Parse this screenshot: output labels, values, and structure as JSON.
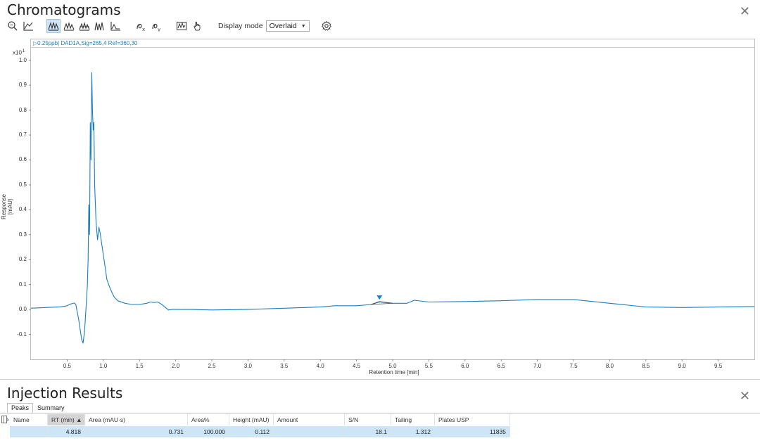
{
  "chromatograms": {
    "title": "Chromatograms",
    "display_mode_label": "Display mode",
    "display_mode_value": "Overlaid",
    "toolbar_icons": [
      "zoom-icon",
      "baseline-icon",
      "overlay-peaks-icon",
      "stacked-peaks-icon",
      "separated-peaks-icon",
      "mirror-peaks-icon",
      "integrate-icon",
      "clear-x-icon",
      "clear-y-icon",
      "spectra-icon",
      "hand-select-icon",
      "settings-icon"
    ],
    "trace_label": "▷0.25ppb| DAD1A,Sig=265,4 Ref=360,30",
    "trace_color": "#1a7fc4",
    "y_multiplier": "x10 1",
    "y_axis_label": "Response [mAU]",
    "x_axis_label": "Retention time [min]"
  },
  "chart_data": {
    "type": "line",
    "xlabel": "Retention time [min]",
    "ylabel": "Response [mAU]",
    "xlim": [
      0.0,
      10.0
    ],
    "ylim": [
      -0.2,
      1.05
    ],
    "x_ticks": [
      "0.5",
      "1.0",
      "1.5",
      "2.0",
      "2.5",
      "3.0",
      "3.5",
      "4.0",
      "4.5",
      "5.0",
      "5.5",
      "6.0",
      "6.5",
      "7.0",
      "7.5",
      "8.0",
      "8.5",
      "9.0",
      "9.5"
    ],
    "y_ticks": [
      "1.0",
      "0.9",
      "0.8",
      "0.7",
      "0.6",
      "0.5",
      "0.4",
      "0.3",
      "0.2",
      "0.1",
      "0.0",
      "-0.1"
    ],
    "series": [
      {
        "x": [
          0.0,
          0.2,
          0.4,
          0.5,
          0.55,
          0.6,
          0.62,
          0.66,
          0.7,
          0.72,
          0.74,
          0.76,
          0.78,
          0.79,
          0.8,
          0.81,
          0.82,
          0.83,
          0.84,
          0.85,
          0.86,
          0.87,
          0.88,
          0.9,
          0.92,
          0.94,
          0.96,
          0.98,
          1.0,
          1.02,
          1.05,
          1.1,
          1.15,
          1.2,
          1.3,
          1.4,
          1.5,
          1.6,
          1.65,
          1.7,
          1.75,
          1.8,
          1.85,
          1.9,
          1.95,
          2.0,
          2.2,
          2.5,
          3.0,
          3.5,
          4.0,
          4.2,
          4.5,
          4.7,
          4.818,
          5.0,
          5.2,
          5.3,
          5.5,
          6.0,
          6.5,
          7.0,
          7.5,
          8.0,
          8.5,
          9.0,
          9.5,
          10.0
        ],
        "y": [
          0.005,
          0.008,
          0.01,
          0.015,
          0.022,
          0.026,
          0.02,
          -0.04,
          -0.12,
          -0.135,
          -0.09,
          0.0,
          0.1,
          0.2,
          0.42,
          0.3,
          0.75,
          0.6,
          0.95,
          0.8,
          0.72,
          0.75,
          0.5,
          0.35,
          0.28,
          0.33,
          0.3,
          0.26,
          0.22,
          0.18,
          0.12,
          0.08,
          0.05,
          0.035,
          0.025,
          0.02,
          0.02,
          0.025,
          0.03,
          0.028,
          0.03,
          0.022,
          0.01,
          -0.002,
          0.0,
          0.0,
          0.0,
          -0.002,
          0.0,
          0.005,
          0.01,
          0.015,
          0.015,
          0.02,
          0.03,
          0.025,
          0.025,
          0.037,
          0.03,
          0.032,
          0.035,
          0.04,
          0.04,
          0.025,
          0.01,
          0.008,
          0.01,
          0.012
        ]
      }
    ],
    "peak_marker": {
      "x": 4.818,
      "y": 0.045
    }
  },
  "results": {
    "title": "Injection Results",
    "tabs": [
      "Peaks",
      "Summary"
    ],
    "columns": [
      "Name",
      "RT (min) ▲",
      "Area (mAU·s)",
      "Area%",
      "Height (mAU)",
      "Amount",
      "S/N",
      "Tailing",
      "Plates USP"
    ],
    "rows": [
      {
        "name": "",
        "rt": "4.818",
        "area": "0.731",
        "area_pct": "100.000",
        "height": "0.112",
        "amount": "",
        "sn": "18.1",
        "tailing": "1.312",
        "plates": "11835"
      }
    ],
    "selected_row_color": "#cde6f7"
  }
}
